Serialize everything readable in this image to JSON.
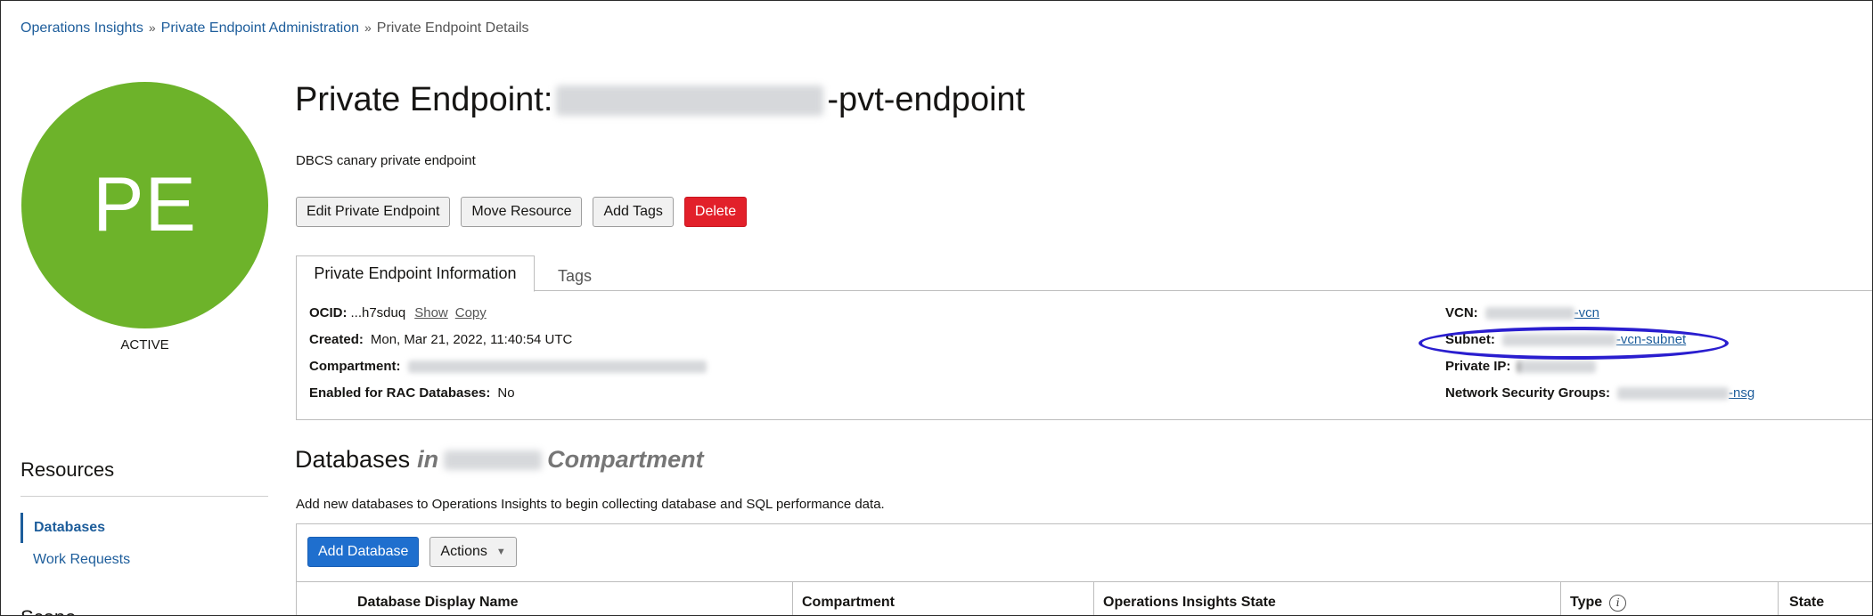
{
  "breadcrumb": {
    "items": [
      "Operations Insights",
      "Private Endpoint Administration"
    ],
    "separator": "»",
    "current": "Private Endpoint Details"
  },
  "badge": {
    "initials": "PE",
    "color": "#6db32a",
    "status": "ACTIVE"
  },
  "header": {
    "title_prefix": "Private Endpoint:",
    "title_suffix": "-pvt-endpoint",
    "description": "DBCS canary private endpoint"
  },
  "actions": {
    "edit": "Edit Private Endpoint",
    "move": "Move Resource",
    "add_tags": "Add Tags",
    "delete": "Delete"
  },
  "tabs": {
    "info": "Private Endpoint Information",
    "tags": "Tags"
  },
  "info": {
    "ocid_label": "OCID:",
    "ocid_value": "...h7sduq",
    "show": "Show",
    "copy": "Copy",
    "created_label": "Created:",
    "created_value": "Mon, Mar 21, 2022, 11:40:54 UTC",
    "compartment_label": "Compartment:",
    "rac_label": "Enabled for RAC Databases:",
    "rac_value": "No",
    "vcn_label": "VCN:",
    "vcn_suffix": "-vcn",
    "subnet_label": "Subnet:",
    "subnet_suffix": "-vcn-subnet",
    "private_ip_label": "Private IP:",
    "nsg_label": "Network Security Groups:",
    "nsg_suffix": "-nsg"
  },
  "resources": {
    "title": "Resources",
    "items": [
      "Databases",
      "Work Requests"
    ],
    "scope_title": "Scope"
  },
  "databases": {
    "title": "Databases",
    "in_word": "in",
    "compartment_word": "Compartment",
    "description": "Add new databases to Operations Insights to begin collecting database and SQL performance data.",
    "add_button": "Add Database",
    "actions_button": "Actions",
    "columns": [
      "Database Display Name",
      "Compartment",
      "Operations Insights State",
      "Type",
      "State"
    ]
  },
  "colors": {
    "link": "#1d5d9b",
    "danger": "#e2202a",
    "primary": "#1f6fce",
    "annotation": "#2a1ecf"
  },
  "icons": {
    "type_info": "info-icon",
    "actions_caret": "caret-down-icon"
  }
}
